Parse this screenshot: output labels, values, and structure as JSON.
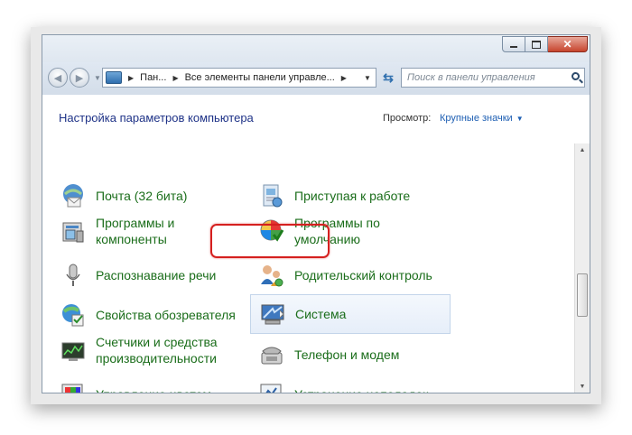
{
  "window": {
    "address": {
      "crumb_1": "Пан...",
      "crumb_2": "Все элементы панели управле..."
    },
    "search": {
      "placeholder": "Поиск в панели управления"
    },
    "caption": {
      "minimize_icon": "minimize-icon",
      "maximize_icon": "maximize-icon",
      "close_icon": "close-icon"
    }
  },
  "content": {
    "heading": "Настройка параметров компьютера",
    "view_label": "Просмотр:",
    "view_value": "Крупные значки",
    "items_left": [
      {
        "label": "Почта (32 бита)",
        "icon": "mail-icon"
      },
      {
        "label": "Программы и\nкомпоненты",
        "icon": "programs-icon"
      },
      {
        "label": "Распознавание речи",
        "icon": "microphone-icon"
      },
      {
        "label": "Свойства обозревателя",
        "icon": "internet-options-icon"
      },
      {
        "label": "Счетчики и средства\nпроизводительности",
        "icon": "performance-icon"
      },
      {
        "label": "Управление цветом",
        "icon": "color-management-icon"
      }
    ],
    "items_right": [
      {
        "label": "Приступая к работе",
        "icon": "getting-started-icon"
      },
      {
        "label": "Программы по\nумолчанию",
        "icon": "default-programs-icon"
      },
      {
        "label": "Родительский контроль",
        "icon": "parental-controls-icon"
      },
      {
        "label": "Система",
        "icon": "system-icon",
        "selected": true
      },
      {
        "label": "Телефон и модем",
        "icon": "phone-modem-icon"
      },
      {
        "label": "Устранение неполадок",
        "icon": "troubleshooting-icon"
      }
    ]
  },
  "colors": {
    "link_green": "#1a6d1a",
    "heading_blue": "#1e3287",
    "highlight_ring": "#d5201f"
  }
}
